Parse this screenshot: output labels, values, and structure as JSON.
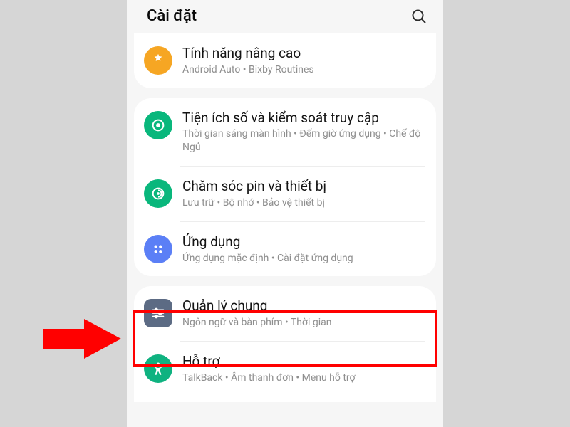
{
  "header": {
    "title": "Cài đặt"
  },
  "items": [
    {
      "title": "Tính năng nâng cao",
      "sub": "Android Auto  •  Bixby Routines"
    },
    {
      "title": "Tiện ích số và kiểm soát truy cập",
      "sub": "Thời gian sáng màn hình  •  Đếm giờ ứng dụng  •  Chế độ Ngủ"
    },
    {
      "title": "Chăm sóc pin và thiết bị",
      "sub": "Lưu trữ  •  Bộ nhớ  •  Bảo vệ thiết bị"
    },
    {
      "title": "Ứng dụng",
      "sub": "Ứng dụng mặc định  •  Cài đặt ứng dụng"
    },
    {
      "title": "Quản lý chung",
      "sub": "Ngôn ngữ và bàn phím  •  Thời gian"
    },
    {
      "title": "Hỗ trợ",
      "sub": "TalkBack  •  Âm thanh đơn  •  Menu hỗ trợ"
    }
  ]
}
